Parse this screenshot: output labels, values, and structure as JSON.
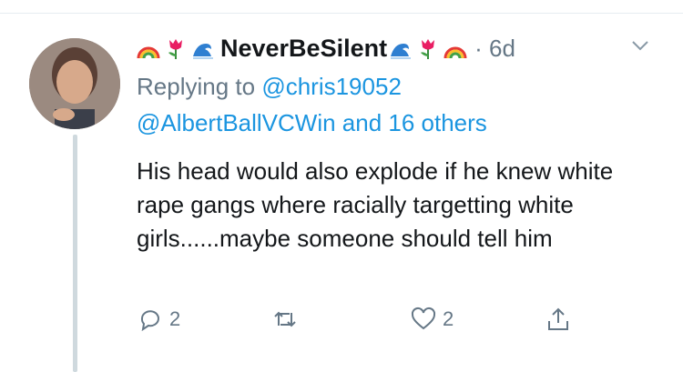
{
  "tweet": {
    "display_name": "NeverBeSilent",
    "name_emojis_left": [
      "rainbow-emoji",
      "tulip-emoji",
      "wave-emoji"
    ],
    "name_emojis_right": [
      "wave-emoji",
      "tulip-emoji",
      "rainbow-emoji"
    ],
    "time": "6d",
    "replying_prefix": "Replying to",
    "replying_to": "@chris19052",
    "mentions_line": "@AlbertBallVCWin and 16 others",
    "text": "His head would also explode if he knew white rape gangs where racially targetting white girls......maybe someone should tell him",
    "actions": {
      "reply_count": "2",
      "retweet_count": "",
      "like_count": "2",
      "icons": [
        "reply-icon",
        "retweet-icon",
        "like-icon",
        "share-icon"
      ]
    }
  },
  "colors": {
    "text": "#14171a",
    "muted": "#657786",
    "link": "#1b95e0",
    "thread_line": "#cfd9de"
  }
}
